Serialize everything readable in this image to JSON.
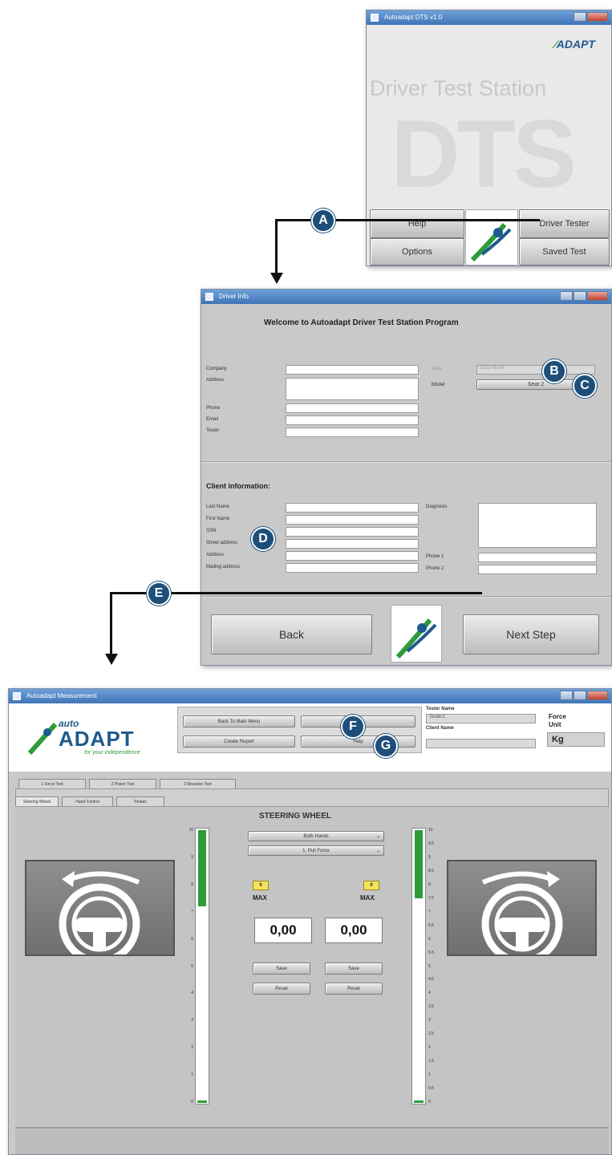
{
  "win1": {
    "title": "Autoadapt DTS v1.0",
    "logo": "ADAPT",
    "station_title": "Driver Test Station",
    "big_letters": "DTS",
    "buttons": {
      "help": "Help",
      "driver_tester": "Driver Tester",
      "options": "Options",
      "saved_test": "Saved Test"
    }
  },
  "win2": {
    "title": "Driver Info",
    "welcome": "Welcome to Autoadapt Driver Test Station Program",
    "company_labels": [
      "Company",
      "Address",
      "Phone",
      "Email",
      "Tester"
    ],
    "right_labels": {
      "date": "Date",
      "model": "Model"
    },
    "date_value": "2012-05-06",
    "model_value": "Seat 2",
    "client_header": "Client information:",
    "client_labels": [
      "Last Name",
      "First Name",
      "SSN",
      "Street address",
      "Address",
      "Mailing address"
    ],
    "client_right_labels": {
      "diagnosis": "Diagnosis",
      "phone1": "Phone 1",
      "phone2": "Phone 2"
    },
    "back": "Back",
    "next": "Next Step"
  },
  "win3": {
    "title": "Autoadapt Measurement",
    "logo_auto": "auto",
    "logo_adapt": "ADAPT",
    "logo_tag": "for your independence",
    "buttons": {
      "back_main": "Back To Main Menu",
      "btn2": "",
      "create_report": "Create Report",
      "help": "Help"
    },
    "tester_label": "Tester Name",
    "tester_value": "Tester1",
    "client_label": "Client Name",
    "client_value": "",
    "force_label": "Force",
    "unit_label": "Unit",
    "unit_value": "Kg",
    "top_tabs": [
      "1 Force Test",
      "2 Power Test",
      "3 Reaction Test"
    ],
    "sub_tabs": [
      "Steering Wheel",
      "Hand Control",
      "Pedals"
    ],
    "panel_title": "STEERING WHEEL",
    "dropdown1": "Both Hands",
    "dropdown2": "1. Pull Force",
    "max_left": "0",
    "max_right": "0",
    "max_label": "MAX",
    "value_left": "0,00",
    "value_right": "0,00",
    "save": "Save",
    "reset": "Reset",
    "left_gauge_ticks": [
      "10",
      "9",
      "8",
      "7",
      "6",
      "5",
      "4",
      "3",
      "2",
      "1",
      "0"
    ],
    "right_gauge_ticks": [
      "10",
      "9.5",
      "9",
      "8.5",
      "8",
      "7.5",
      "7",
      "6.5",
      "6",
      "5.5",
      "5",
      "4.5",
      "4",
      "3.5",
      "3",
      "2.5",
      "2",
      "1.5",
      "1",
      "0.5",
      "0"
    ],
    "left_gauge_level": 0.72,
    "right_gauge_level": 0.75
  },
  "callouts": [
    "A",
    "B",
    "C",
    "D",
    "E",
    "F",
    "G"
  ],
  "colors": {
    "callout": "#1e4f7a",
    "gauge": "#2c9c3a",
    "max": "#f4e35a"
  }
}
